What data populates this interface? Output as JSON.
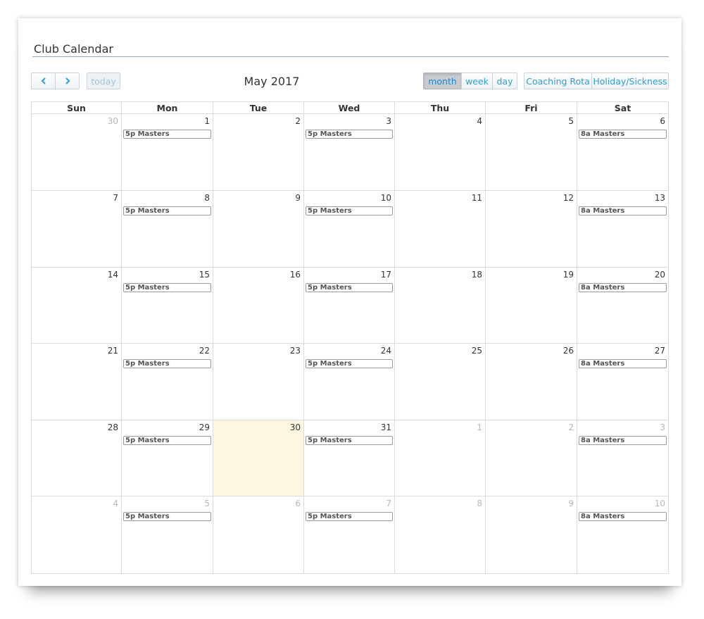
{
  "header": {
    "title": "Club Calendar"
  },
  "toolbar": {
    "prev_icon": "chevron-left-icon",
    "next_icon": "chevron-right-icon",
    "today_label": "today",
    "current_month": "May 2017",
    "views": [
      {
        "label": "month",
        "active": true
      },
      {
        "label": "week",
        "active": false
      },
      {
        "label": "day",
        "active": false
      }
    ],
    "extra_buttons": [
      "Coaching Rota",
      "Holiday/Sickness"
    ]
  },
  "calendar": {
    "weekdays": [
      "Sun",
      "Mon",
      "Tue",
      "Wed",
      "Thu",
      "Fri",
      "Sat"
    ],
    "weeks": [
      [
        {
          "day": "30",
          "other": true,
          "event": ""
        },
        {
          "day": "1",
          "other": false,
          "event": "5p Masters"
        },
        {
          "day": "2",
          "other": false,
          "event": ""
        },
        {
          "day": "3",
          "other": false,
          "event": "5p Masters"
        },
        {
          "day": "4",
          "other": false,
          "event": ""
        },
        {
          "day": "5",
          "other": false,
          "event": ""
        },
        {
          "day": "6",
          "other": false,
          "event": "8a Masters"
        }
      ],
      [
        {
          "day": "7",
          "other": false,
          "event": ""
        },
        {
          "day": "8",
          "other": false,
          "event": "5p Masters"
        },
        {
          "day": "9",
          "other": false,
          "event": ""
        },
        {
          "day": "10",
          "other": false,
          "event": "5p Masters"
        },
        {
          "day": "11",
          "other": false,
          "event": ""
        },
        {
          "day": "12",
          "other": false,
          "event": ""
        },
        {
          "day": "13",
          "other": false,
          "event": "8a Masters"
        }
      ],
      [
        {
          "day": "14",
          "other": false,
          "event": ""
        },
        {
          "day": "15",
          "other": false,
          "event": "5p Masters"
        },
        {
          "day": "16",
          "other": false,
          "event": ""
        },
        {
          "day": "17",
          "other": false,
          "event": "5p Masters"
        },
        {
          "day": "18",
          "other": false,
          "event": ""
        },
        {
          "day": "19",
          "other": false,
          "event": ""
        },
        {
          "day": "20",
          "other": false,
          "event": "8a Masters"
        }
      ],
      [
        {
          "day": "21",
          "other": false,
          "event": ""
        },
        {
          "day": "22",
          "other": false,
          "event": "5p Masters"
        },
        {
          "day": "23",
          "other": false,
          "event": ""
        },
        {
          "day": "24",
          "other": false,
          "event": "5p Masters"
        },
        {
          "day": "25",
          "other": false,
          "event": ""
        },
        {
          "day": "26",
          "other": false,
          "event": ""
        },
        {
          "day": "27",
          "other": false,
          "event": "8a Masters"
        }
      ],
      [
        {
          "day": "28",
          "other": false,
          "event": ""
        },
        {
          "day": "29",
          "other": false,
          "event": "5p Masters"
        },
        {
          "day": "30",
          "other": false,
          "event": "",
          "today": true
        },
        {
          "day": "31",
          "other": false,
          "event": "5p Masters"
        },
        {
          "day": "1",
          "other": true,
          "event": ""
        },
        {
          "day": "2",
          "other": true,
          "event": ""
        },
        {
          "day": "3",
          "other": true,
          "event": "8a Masters"
        }
      ],
      [
        {
          "day": "4",
          "other": true,
          "event": ""
        },
        {
          "day": "5",
          "other": true,
          "event": "5p Masters"
        },
        {
          "day": "6",
          "other": true,
          "event": ""
        },
        {
          "day": "7",
          "other": true,
          "event": "5p Masters"
        },
        {
          "day": "8",
          "other": true,
          "event": ""
        },
        {
          "day": "9",
          "other": true,
          "event": ""
        },
        {
          "day": "10",
          "other": true,
          "event": "8a Masters"
        }
      ]
    ]
  },
  "colors": {
    "accent": "#2a9fd6",
    "today_bg": "#fcf8e3",
    "border": "#dcdcdc"
  }
}
